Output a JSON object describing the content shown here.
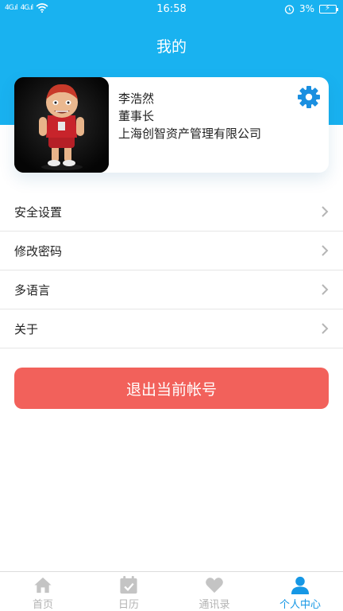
{
  "status_bar": {
    "signal_1": "4G.ıl",
    "signal_2": "4G.ıl",
    "time": "16:58",
    "battery_percent": "3%",
    "icons": [
      "wifi-icon",
      "alarm-icon",
      "battery-charging-icon"
    ]
  },
  "header": {
    "title": "我的"
  },
  "profile": {
    "name": "李浩然",
    "position": "董事长",
    "company": "上海创智资产管理有限公司",
    "settings_icon": "gear-icon"
  },
  "menu": {
    "items": [
      {
        "label": "安全设置"
      },
      {
        "label": "修改密码"
      },
      {
        "label": "多语言"
      },
      {
        "label": "关于"
      }
    ]
  },
  "logout": {
    "label": "退出当前帐号"
  },
  "tabbar": {
    "items": [
      {
        "label": "首页",
        "icon": "home-icon",
        "active": false
      },
      {
        "label": "日历",
        "icon": "calendar-icon",
        "active": false
      },
      {
        "label": "通讯录",
        "icon": "heart-icon",
        "active": false
      },
      {
        "label": "个人中心",
        "icon": "person-icon",
        "active": true
      }
    ]
  },
  "colors": {
    "primary": "#19b2f0",
    "danger": "#f2615b",
    "active_tab": "#1597e5",
    "inactive_tab": "#b3b3b3"
  }
}
